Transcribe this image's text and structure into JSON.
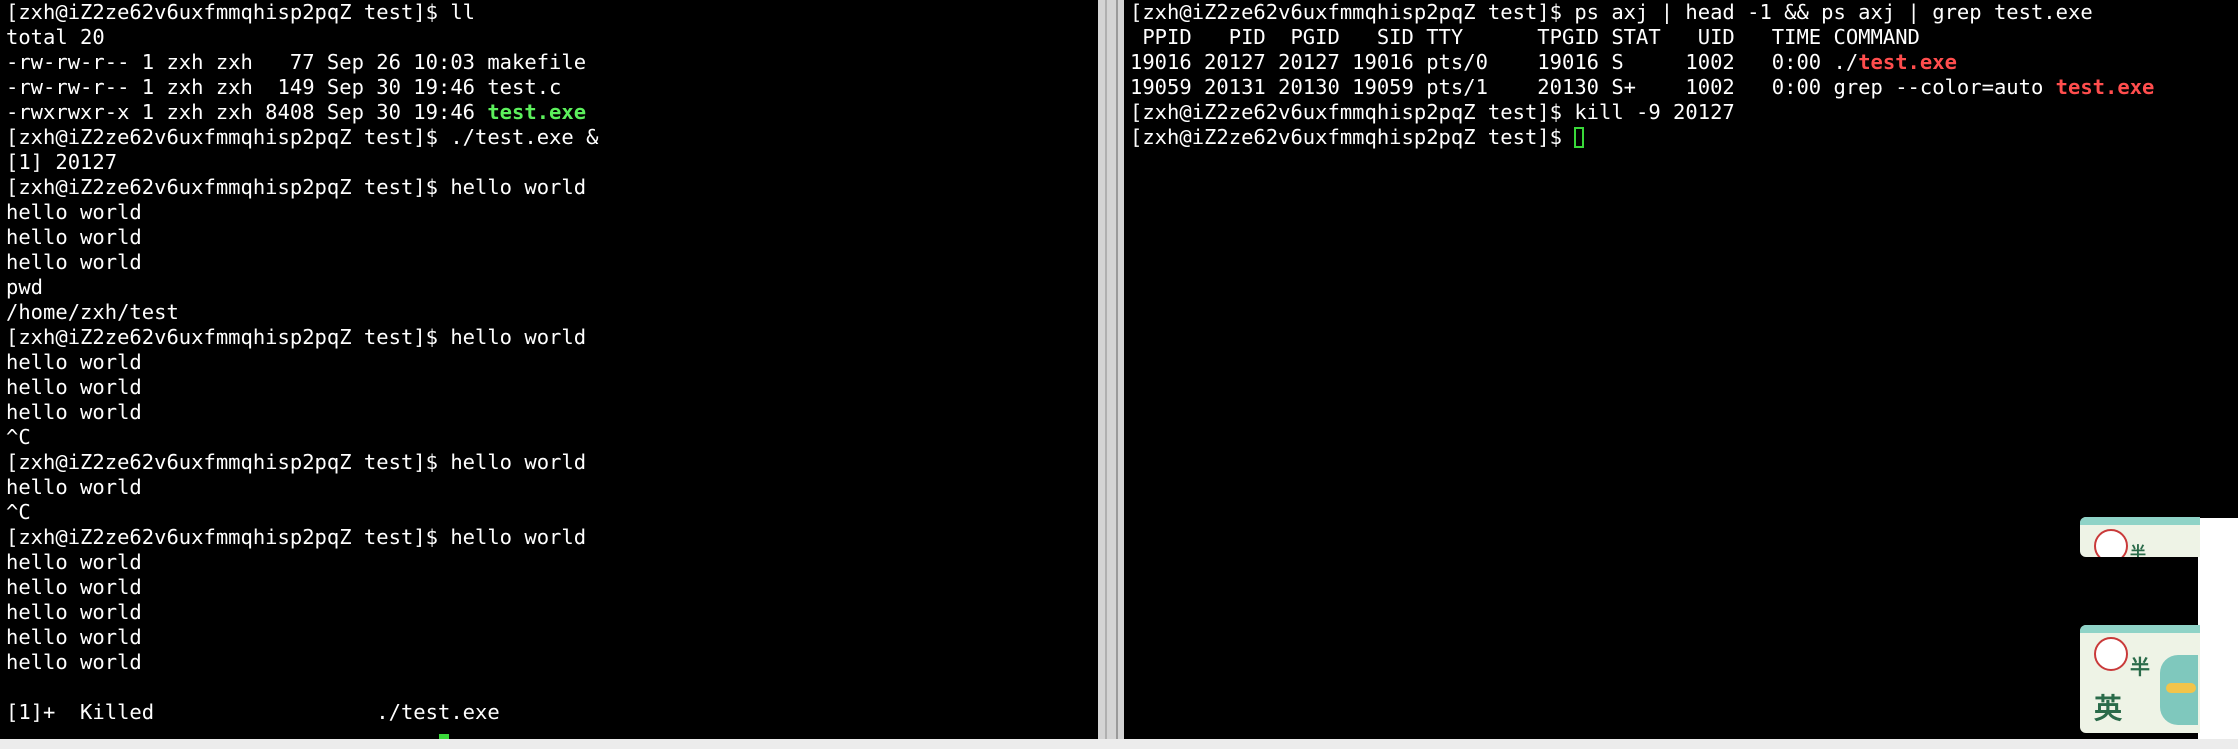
{
  "left_terminal": {
    "lines": [
      [
        {
          "text": "[zxh@iZ2ze62v6uxfmmqhisp2pqZ test]$ ll"
        }
      ],
      [
        {
          "text": "total 20"
        }
      ],
      [
        {
          "text": "-rw-rw-r-- 1 zxh zxh   77 Sep 26 10:03 makefile"
        }
      ],
      [
        {
          "text": "-rw-rw-r-- 1 zxh zxh  149 Sep 30 19:46 test.c"
        }
      ],
      [
        {
          "text": "-rwxrwxr-x 1 zxh zxh 8408 Sep 30 19:46 "
        },
        {
          "text": "test.exe",
          "style": "green"
        }
      ],
      [
        {
          "text": "[zxh@iZ2ze62v6uxfmmqhisp2pqZ test]$ ./test.exe &"
        }
      ],
      [
        {
          "text": "[1] 20127"
        }
      ],
      [
        {
          "text": "[zxh@iZ2ze62v6uxfmmqhisp2pqZ test]$ hello world"
        }
      ],
      [
        {
          "text": "hello world"
        }
      ],
      [
        {
          "text": "hello world"
        }
      ],
      [
        {
          "text": "hello world"
        }
      ],
      [
        {
          "text": "pwd"
        }
      ],
      [
        {
          "text": "/home/zxh/test"
        }
      ],
      [
        {
          "text": "[zxh@iZ2ze62v6uxfmmqhisp2pqZ test]$ hello world"
        }
      ],
      [
        {
          "text": "hello world"
        }
      ],
      [
        {
          "text": "hello world"
        }
      ],
      [
        {
          "text": "hello world"
        }
      ],
      [
        {
          "text": "^C"
        }
      ],
      [
        {
          "text": "[zxh@iZ2ze62v6uxfmmqhisp2pqZ test]$ hello world"
        }
      ],
      [
        {
          "text": "hello world"
        }
      ],
      [
        {
          "text": "^C"
        }
      ],
      [
        {
          "text": "[zxh@iZ2ze62v6uxfmmqhisp2pqZ test]$ hello world"
        }
      ],
      [
        {
          "text": "hello world"
        }
      ],
      [
        {
          "text": "hello world"
        }
      ],
      [
        {
          "text": "hello world"
        }
      ],
      [
        {
          "text": "hello world"
        }
      ],
      [
        {
          "text": "hello world"
        }
      ],
      [
        {
          "text": ""
        }
      ],
      [
        {
          "text": "[1]+  Killed                  ./test.exe"
        }
      ]
    ]
  },
  "right_terminal": {
    "lines": [
      [
        {
          "text": "[zxh@iZ2ze62v6uxfmmqhisp2pqZ test]$ ps axj | head -1 && ps axj | grep test.exe"
        }
      ],
      [
        {
          "text": " PPID   PID  PGID   SID TTY      TPGID STAT   UID   TIME COMMAND"
        }
      ],
      [
        {
          "text": "19016 20127 20127 19016 pts/0    19016 S     1002   0:00 ./"
        },
        {
          "text": "test.exe",
          "style": "red"
        }
      ],
      [
        {
          "text": "19059 20131 20130 19059 pts/1    20130 S+    1002   0:00 grep --color=auto "
        },
        {
          "text": "test.exe",
          "style": "red"
        }
      ],
      [
        {
          "text": "[zxh@iZ2ze62v6uxfmmqhisp2pqZ test]$ kill -9 20127"
        }
      ],
      [
        {
          "text": "[zxh@iZ2ze62v6uxfmmqhisp2pqZ test]$ "
        },
        {
          "text": "",
          "style": "cursor"
        }
      ]
    ]
  },
  "overlay_widget": {
    "top_text": "半",
    "bottom_text": "英"
  },
  "colors": {
    "terminal_bg": "#000000",
    "terminal_fg": "#ffffff",
    "executable_highlight": "#5cf05c",
    "grep_match_highlight": "#ff4d4d",
    "cursor": "#39d939"
  }
}
